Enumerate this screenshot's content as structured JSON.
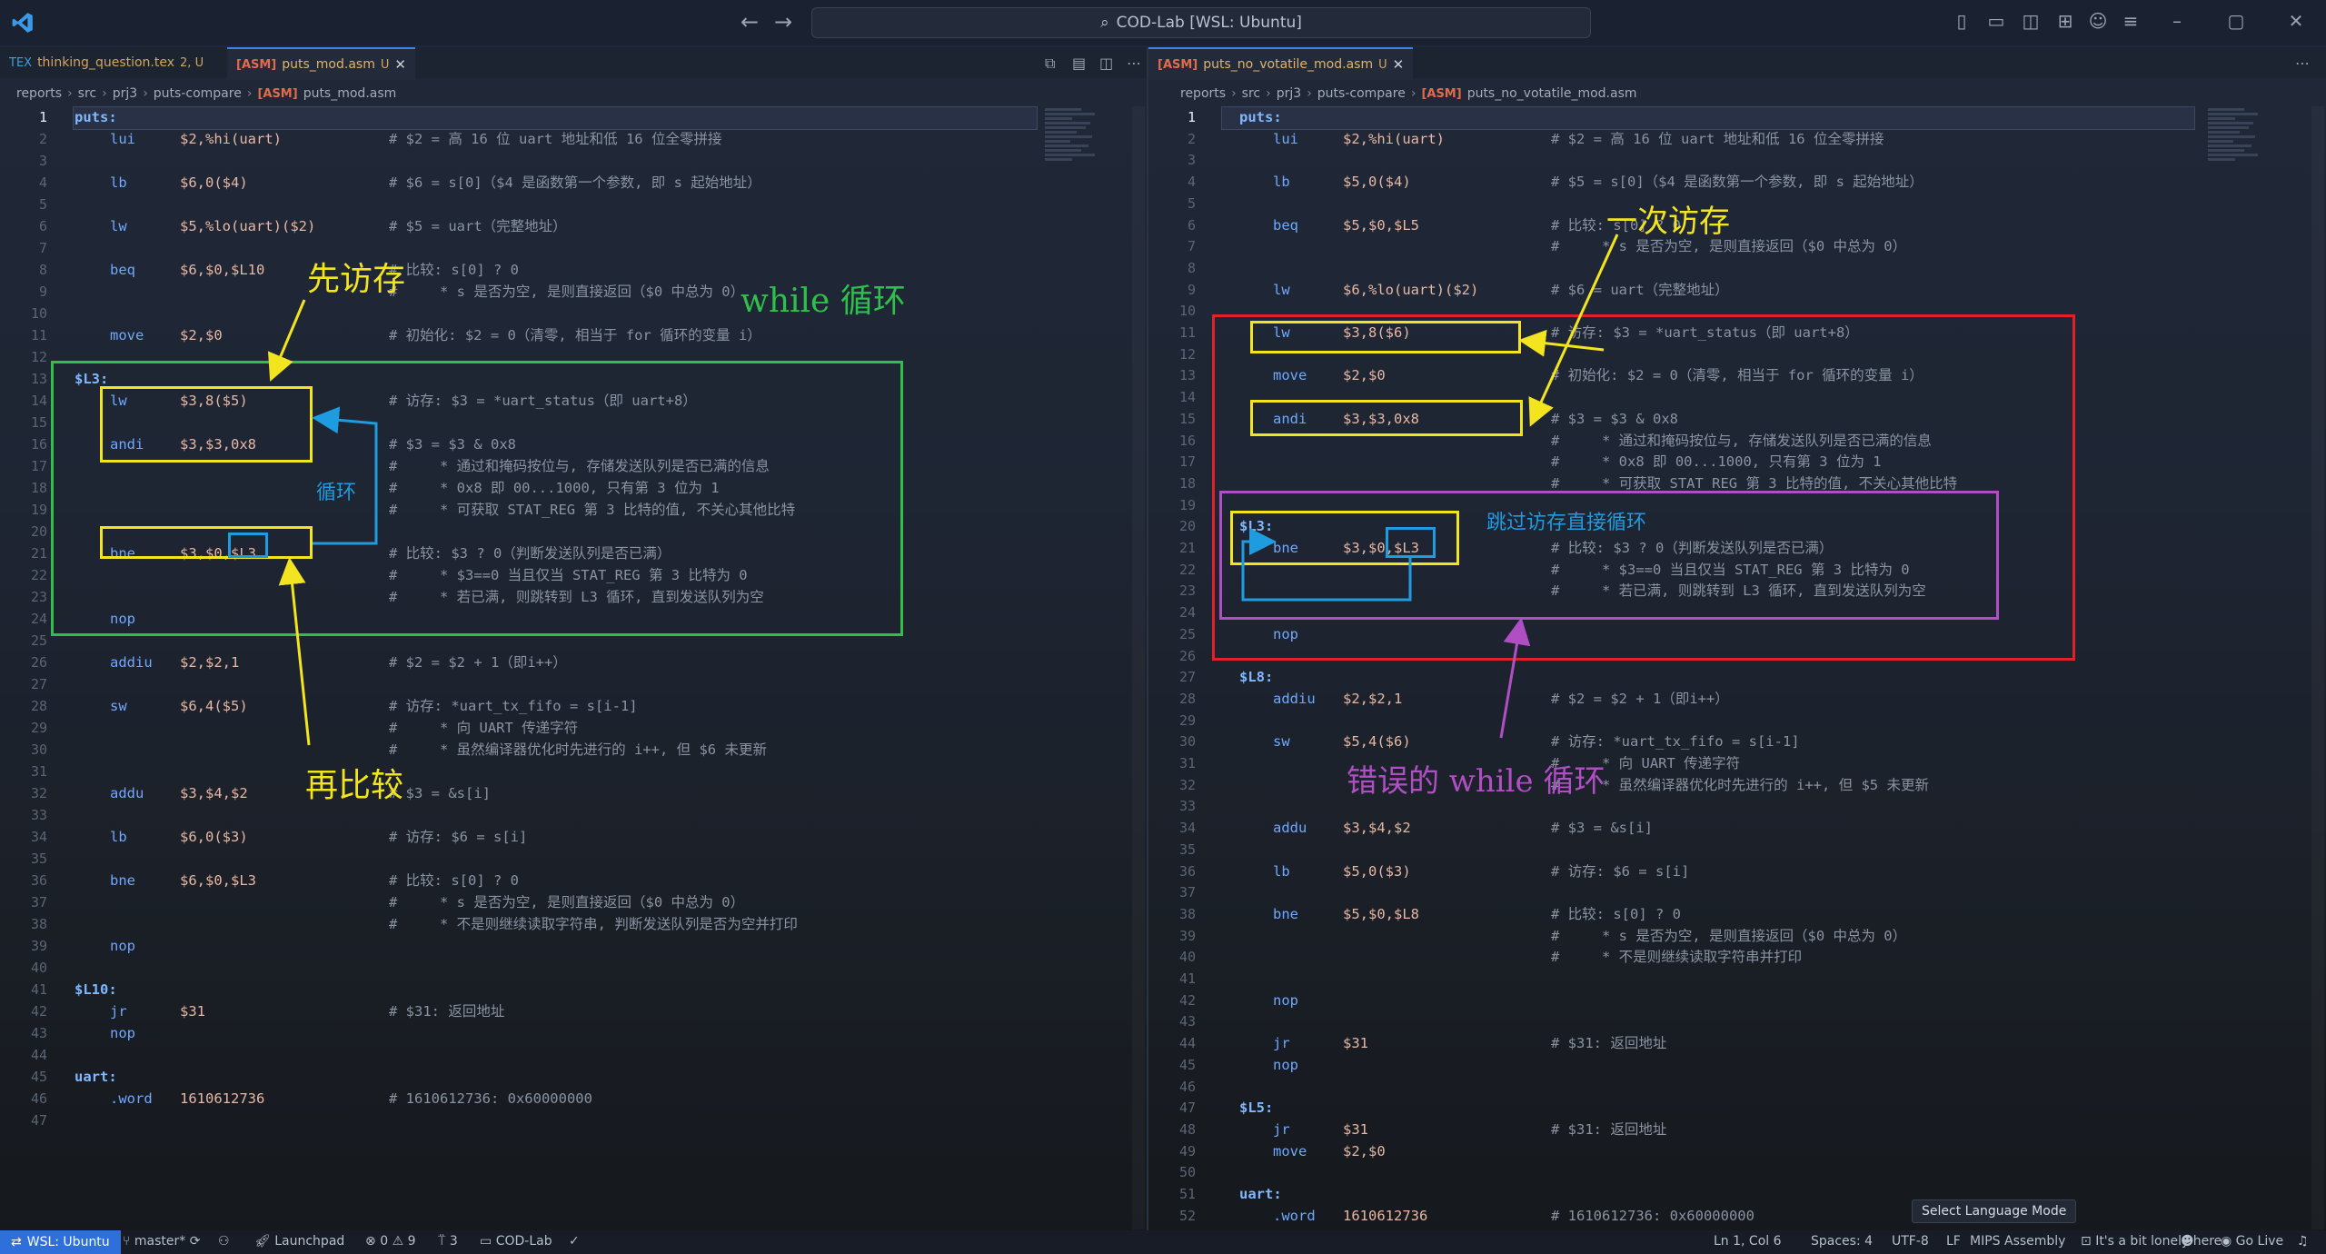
{
  "titlebar": {
    "search_text": "COD-Lab [WSL: Ubuntu]"
  },
  "left": {
    "tabs": [
      {
        "name": "thinking_question.tex",
        "status": "2, U"
      },
      {
        "name": "puts_mod.asm",
        "status": "U"
      }
    ],
    "breadcrumb": [
      "reports",
      "src",
      "prj3",
      "puts-compare",
      "puts_mod.asm"
    ],
    "lines": [
      {
        "n": "1",
        "label": "puts:",
        "op": "",
        "args": "",
        "cmt": ""
      },
      {
        "n": "2",
        "label": "",
        "op": "lui",
        "args": "$2,%hi(uart)",
        "cmt": "# $2 = 高 16 位 uart 地址和低 16 位全零拼接"
      },
      {
        "n": "3",
        "label": "",
        "op": "",
        "args": "",
        "cmt": ""
      },
      {
        "n": "4",
        "label": "",
        "op": "lb",
        "args": "$6,0($4)",
        "cmt": "# $6 = s[0]（$4 是函数第一个参数, 即 s 起始地址）"
      },
      {
        "n": "5",
        "label": "",
        "op": "",
        "args": "",
        "cmt": ""
      },
      {
        "n": "6",
        "label": "",
        "op": "lw",
        "args": "$5,%lo(uart)($2)",
        "cmt": "# $5 = uart（完整地址）"
      },
      {
        "n": "7",
        "label": "",
        "op": "",
        "args": "",
        "cmt": ""
      },
      {
        "n": "8",
        "label": "",
        "op": "beq",
        "args": "$6,$0,$L10",
        "cmt": "# 比较: s[0] ? 0"
      },
      {
        "n": "9",
        "label": "",
        "op": "",
        "args": "",
        "cmt": "#     * s 是否为空, 是则直接返回（$0 中总为 0）"
      },
      {
        "n": "10",
        "label": "",
        "op": "",
        "args": "",
        "cmt": ""
      },
      {
        "n": "11",
        "label": "",
        "op": "move",
        "args": "$2,$0",
        "cmt": "# 初始化: $2 = 0（清零, 相当于 for 循环的变量 i）"
      },
      {
        "n": "12",
        "label": "",
        "op": "",
        "args": "",
        "cmt": ""
      },
      {
        "n": "13",
        "label": "$L3:",
        "op": "",
        "args": "",
        "cmt": ""
      },
      {
        "n": "14",
        "label": "",
        "op": "lw",
        "args": "$3,8($5)",
        "cmt": "# 访存: $3 = *uart_status（即 uart+8）"
      },
      {
        "n": "15",
        "label": "",
        "op": "",
        "args": "",
        "cmt": ""
      },
      {
        "n": "16",
        "label": "",
        "op": "andi",
        "args": "$3,$3,0x8",
        "cmt": "# $3 = $3 & 0x8"
      },
      {
        "n": "17",
        "label": "",
        "op": "",
        "args": "",
        "cmt": "#     * 通过和掩码按位与, 存储发送队列是否已满的信息"
      },
      {
        "n": "18",
        "label": "",
        "op": "",
        "args": "",
        "cmt": "#     * 0x8 即 00...1000, 只有第 3 位为 1"
      },
      {
        "n": "19",
        "label": "",
        "op": "",
        "args": "",
        "cmt": "#     * 可获取 STAT_REG 第 3 比特的值, 不关心其他比特"
      },
      {
        "n": "20",
        "label": "",
        "op": "",
        "args": "",
        "cmt": ""
      },
      {
        "n": "21",
        "label": "",
        "op": "bne",
        "args": "$3,$0,$L3",
        "cmt": "# 比较: $3 ? 0（判断发送队列是否已满）"
      },
      {
        "n": "22",
        "label": "",
        "op": "",
        "args": "",
        "cmt": "#     * $3==0 当且仅当 STAT_REG 第 3 比特为 0"
      },
      {
        "n": "23",
        "label": "",
        "op": "",
        "args": "",
        "cmt": "#     * 若已满, 则跳转到 L3 循环, 直到发送队列为空"
      },
      {
        "n": "24",
        "label": "",
        "op": "nop",
        "args": "",
        "cmt": ""
      },
      {
        "n": "25",
        "label": "",
        "op": "",
        "args": "",
        "cmt": ""
      },
      {
        "n": "26",
        "label": "",
        "op": "addiu",
        "args": "$2,$2,1",
        "cmt": "# $2 = $2 + 1（即i++）"
      },
      {
        "n": "27",
        "label": "",
        "op": "",
        "args": "",
        "cmt": ""
      },
      {
        "n": "28",
        "label": "",
        "op": "sw",
        "args": "$6,4($5)",
        "cmt": "# 访存: *uart_tx_fifo = s[i-1]"
      },
      {
        "n": "29",
        "label": "",
        "op": "",
        "args": "",
        "cmt": "#     * 向 UART 传递字符"
      },
      {
        "n": "30",
        "label": "",
        "op": "",
        "args": "",
        "cmt": "#     * 虽然编译器优化时先进行的 i++, 但 $6 未更新"
      },
      {
        "n": "31",
        "label": "",
        "op": "",
        "args": "",
        "cmt": ""
      },
      {
        "n": "32",
        "label": "",
        "op": "addu",
        "args": "$3,$4,$2",
        "cmt": "# $3 = &s[i]"
      },
      {
        "n": "33",
        "label": "",
        "op": "",
        "args": "",
        "cmt": ""
      },
      {
        "n": "34",
        "label": "",
        "op": "lb",
        "args": "$6,0($3)",
        "cmt": "# 访存: $6 = s[i]"
      },
      {
        "n": "35",
        "label": "",
        "op": "",
        "args": "",
        "cmt": ""
      },
      {
        "n": "36",
        "label": "",
        "op": "bne",
        "args": "$6,$0,$L3",
        "cmt": "# 比较: s[0] ? 0"
      },
      {
        "n": "37",
        "label": "",
        "op": "",
        "args": "",
        "cmt": "#     * s 是否为空, 是则直接返回（$0 中总为 0）"
      },
      {
        "n": "38",
        "label": "",
        "op": "",
        "args": "",
        "cmt": "#     * 不是则继续读取字符串, 判断发送队列是否为空并打印"
      },
      {
        "n": "39",
        "label": "",
        "op": "nop",
        "args": "",
        "cmt": ""
      },
      {
        "n": "40",
        "label": "",
        "op": "",
        "args": "",
        "cmt": ""
      },
      {
        "n": "41",
        "label": "$L10:",
        "op": "",
        "args": "",
        "cmt": ""
      },
      {
        "n": "42",
        "label": "",
        "op": "jr",
        "args": "$31",
        "cmt": "# $31: 返回地址"
      },
      {
        "n": "43",
        "label": "",
        "op": "nop",
        "args": "",
        "cmt": ""
      },
      {
        "n": "44",
        "label": "",
        "op": "",
        "args": "",
        "cmt": ""
      },
      {
        "n": "45",
        "label": "uart:",
        "op": "",
        "args": "",
        "cmt": ""
      },
      {
        "n": "46",
        "label": "",
        "op": ".word",
        "args": "1610612736",
        "cmt": "# 1610612736: 0x60000000"
      },
      {
        "n": "47",
        "label": "",
        "op": "",
        "args": "",
        "cmt": ""
      }
    ],
    "annotations": {
      "first_access": "先访存",
      "then_compare": "再比较",
      "while_loop": "while 循环",
      "loop": "循环"
    }
  },
  "right": {
    "tabs": [
      {
        "name": "puts_no_votatile_mod.asm",
        "status": "U"
      }
    ],
    "breadcrumb": [
      "reports",
      "src",
      "prj3",
      "puts-compare",
      "puts_no_votatile_mod.asm"
    ],
    "lines": [
      {
        "n": "1",
        "label": "puts:",
        "op": "",
        "args": "",
        "cmt": ""
      },
      {
        "n": "2",
        "label": "",
        "op": "lui",
        "args": "$2,%hi(uart)",
        "cmt": "# $2 = 高 16 位 uart 地址和低 16 位全零拼接"
      },
      {
        "n": "3",
        "label": "",
        "op": "",
        "args": "",
        "cmt": ""
      },
      {
        "n": "4",
        "label": "",
        "op": "lb",
        "args": "$5,0($4)",
        "cmt": "# $5 = s[0]（$4 是函数第一个参数, 即 s 起始地址）"
      },
      {
        "n": "5",
        "label": "",
        "op": "",
        "args": "",
        "cmt": ""
      },
      {
        "n": "6",
        "label": "",
        "op": "beq",
        "args": "$5,$0,$L5",
        "cmt": "# 比较: s[0] ? 0"
      },
      {
        "n": "7",
        "label": "",
        "op": "",
        "args": "",
        "cmt": "#     * s 是否为空, 是则直接返回（$0 中总为 0）"
      },
      {
        "n": "8",
        "label": "",
        "op": "",
        "args": "",
        "cmt": ""
      },
      {
        "n": "9",
        "label": "",
        "op": "lw",
        "args": "$6,%lo(uart)($2)",
        "cmt": "# $6 = uart（完整地址）"
      },
      {
        "n": "10",
        "label": "",
        "op": "",
        "args": "",
        "cmt": ""
      },
      {
        "n": "11",
        "label": "",
        "op": "lw",
        "args": "$3,8($6)",
        "cmt": "# 访存: $3 = *uart_status（即 uart+8）"
      },
      {
        "n": "12",
        "label": "",
        "op": "",
        "args": "",
        "cmt": ""
      },
      {
        "n": "13",
        "label": "",
        "op": "move",
        "args": "$2,$0",
        "cmt": "# 初始化: $2 = 0（清零, 相当于 for 循环的变量 i）"
      },
      {
        "n": "14",
        "label": "",
        "op": "",
        "args": "",
        "cmt": ""
      },
      {
        "n": "15",
        "label": "",
        "op": "andi",
        "args": "$3,$3,0x8",
        "cmt": "# $3 = $3 & 0x8"
      },
      {
        "n": "16",
        "label": "",
        "op": "",
        "args": "",
        "cmt": "#     * 通过和掩码按位与, 存储发送队列是否已满的信息"
      },
      {
        "n": "17",
        "label": "",
        "op": "",
        "args": "",
        "cmt": "#     * 0x8 即 00...1000, 只有第 3 位为 1"
      },
      {
        "n": "18",
        "label": "",
        "op": "",
        "args": "",
        "cmt": "#     * 可获取 STAT_REG 第 3 比特的值, 不关心其他比特"
      },
      {
        "n": "19",
        "label": "",
        "op": "",
        "args": "",
        "cmt": ""
      },
      {
        "n": "20",
        "label": "$L3:",
        "op": "",
        "args": "",
        "cmt": ""
      },
      {
        "n": "21",
        "label": "",
        "op": "bne",
        "args": "$3,$0,$L3",
        "cmt": "# 比较: $3 ? 0（判断发送队列是否已满）"
      },
      {
        "n": "22",
        "label": "",
        "op": "",
        "args": "",
        "cmt": "#     * $3==0 当且仅当 STAT_REG 第 3 比特为 0"
      },
      {
        "n": "23",
        "label": "",
        "op": "",
        "args": "",
        "cmt": "#     * 若已满, 则跳转到 L3 循环, 直到发送队列为空"
      },
      {
        "n": "24",
        "label": "",
        "op": "",
        "args": "",
        "cmt": ""
      },
      {
        "n": "25",
        "label": "",
        "op": "nop",
        "args": "",
        "cmt": ""
      },
      {
        "n": "26",
        "label": "",
        "op": "",
        "args": "",
        "cmt": ""
      },
      {
        "n": "27",
        "label": "$L8:",
        "op": "",
        "args": "",
        "cmt": ""
      },
      {
        "n": "28",
        "label": "",
        "op": "addiu",
        "args": "$2,$2,1",
        "cmt": "# $2 = $2 + 1（即i++）"
      },
      {
        "n": "29",
        "label": "",
        "op": "",
        "args": "",
        "cmt": ""
      },
      {
        "n": "30",
        "label": "",
        "op": "sw",
        "args": "$5,4($6)",
        "cmt": "# 访存: *uart_tx_fifo = s[i-1]"
      },
      {
        "n": "31",
        "label": "",
        "op": "",
        "args": "",
        "cmt": "#     * 向 UART 传递字符"
      },
      {
        "n": "32",
        "label": "",
        "op": "",
        "args": "",
        "cmt": "#     * 虽然编译器优化时先进行的 i++, 但 $5 未更新"
      },
      {
        "n": "33",
        "label": "",
        "op": "",
        "args": "",
        "cmt": ""
      },
      {
        "n": "34",
        "label": "",
        "op": "addu",
        "args": "$3,$4,$2",
        "cmt": "# $3 = &s[i]"
      },
      {
        "n": "35",
        "label": "",
        "op": "",
        "args": "",
        "cmt": ""
      },
      {
        "n": "36",
        "label": "",
        "op": "lb",
        "args": "$5,0($3)",
        "cmt": "# 访存: $6 = s[i]"
      },
      {
        "n": "37",
        "label": "",
        "op": "",
        "args": "",
        "cmt": ""
      },
      {
        "n": "38",
        "label": "",
        "op": "bne",
        "args": "$5,$0,$L8",
        "cmt": "# 比较: s[0] ? 0"
      },
      {
        "n": "39",
        "label": "",
        "op": "",
        "args": "",
        "cmt": "#     * s 是否为空, 是则直接返回（$0 中总为 0）"
      },
      {
        "n": "40",
        "label": "",
        "op": "",
        "args": "",
        "cmt": "#     * 不是则继续读取字符串并打印"
      },
      {
        "n": "41",
        "label": "",
        "op": "",
        "args": "",
        "cmt": ""
      },
      {
        "n": "42",
        "label": "",
        "op": "nop",
        "args": "",
        "cmt": ""
      },
      {
        "n": "43",
        "label": "",
        "op": "",
        "args": "",
        "cmt": ""
      },
      {
        "n": "44",
        "label": "",
        "op": "jr",
        "args": "$31",
        "cmt": "# $31: 返回地址"
      },
      {
        "n": "45",
        "label": "",
        "op": "nop",
        "args": "",
        "cmt": ""
      },
      {
        "n": "46",
        "label": "",
        "op": "",
        "args": "",
        "cmt": ""
      },
      {
        "n": "47",
        "label": "$L5:",
        "op": "",
        "args": "",
        "cmt": ""
      },
      {
        "n": "48",
        "label": "",
        "op": "jr",
        "args": "$31",
        "cmt": "# $31: 返回地址"
      },
      {
        "n": "49",
        "label": "",
        "op": "move",
        "args": "$2,$0",
        "cmt": ""
      },
      {
        "n": "50",
        "label": "",
        "op": "",
        "args": "",
        "cmt": ""
      },
      {
        "n": "51",
        "label": "uart:",
        "op": "",
        "args": "",
        "cmt": ""
      },
      {
        "n": "52",
        "label": "",
        "op": ".word",
        "args": "1610612736",
        "cmt": "# 1610612736: 0x60000000"
      }
    ],
    "annotations": {
      "single_access": "一次访存",
      "skip_access_loop": "跳过访存直接循环",
      "wrong_while_loop": "错误的 while 循环"
    }
  },
  "tooltip": "Select Language Mode",
  "statusbar": {
    "remote": "WSL: Ubuntu",
    "branch": "master*",
    "launchpad": "Launchpad",
    "errors": "0",
    "warnings": "9",
    "ports": "3",
    "workspace": "COD-Lab",
    "position": "Ln 1, Col 6",
    "spaces": "Spaces: 4",
    "encoding": "UTF-8",
    "eol": "LF",
    "language": "MIPS Assembly",
    "extra": "It's a bit lonely here",
    "golive": "Go Live"
  },
  "colors": {
    "green_box": "#2fbf4a",
    "yellow_box": "#f2e51f",
    "blue_box": "#1f9be0",
    "red_box": "#e0202a",
    "purple_box": "#b04fc4",
    "accent": "#2f6fdb"
  }
}
